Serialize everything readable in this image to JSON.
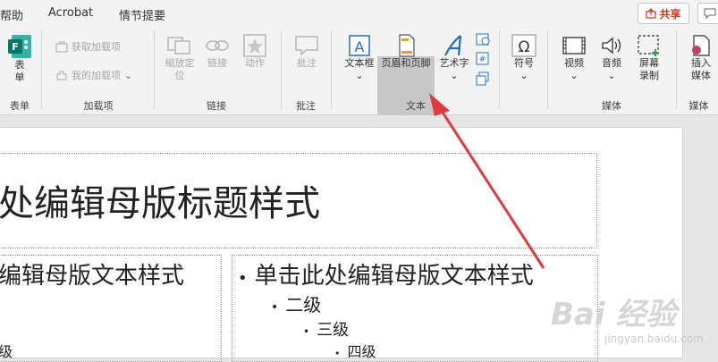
{
  "tabs": [
    "帮助",
    "Acrobat",
    "情节提要"
  ],
  "share_label": "共享",
  "ribbon": {
    "groups": {
      "forms": "表单",
      "addins": "加载项",
      "links": "链接",
      "comments": "批注",
      "text": "文本",
      "media": "媒体",
      "media2": "媒体"
    },
    "forms_button": "表\n单",
    "get_addins": "获取加载项",
    "my_addins": "我的加载项",
    "zoom_label": "缩放定",
    "zoom_label2": "位",
    "link_label": "链接",
    "action_label": "动作",
    "comment_label": "批注",
    "textbox_label": "文本框",
    "header_footer_label": "页眉和页脚",
    "wordart_label": "艺术字",
    "symbol_label": "符号",
    "video_label": "视频",
    "audio_label": "音频",
    "screen_rec_label": "屏幕",
    "screen_rec_label2": "录制",
    "insert_media_label": "插入",
    "insert_media_label2": "媒体"
  },
  "slide": {
    "title": "处编辑母版标题样式",
    "left_body": "编辑母版文本样式",
    "left_level4": "级",
    "right_level1": "单击此处编辑母版文本样式",
    "right_level2": "二级",
    "right_level3": "三级",
    "right_level4": "四级"
  },
  "watermark": "Bai 经验",
  "watermark_sub": "jingyan.baidu.com",
  "colors": {
    "arrow": "#e0393e",
    "accent": "#c43e1c"
  }
}
